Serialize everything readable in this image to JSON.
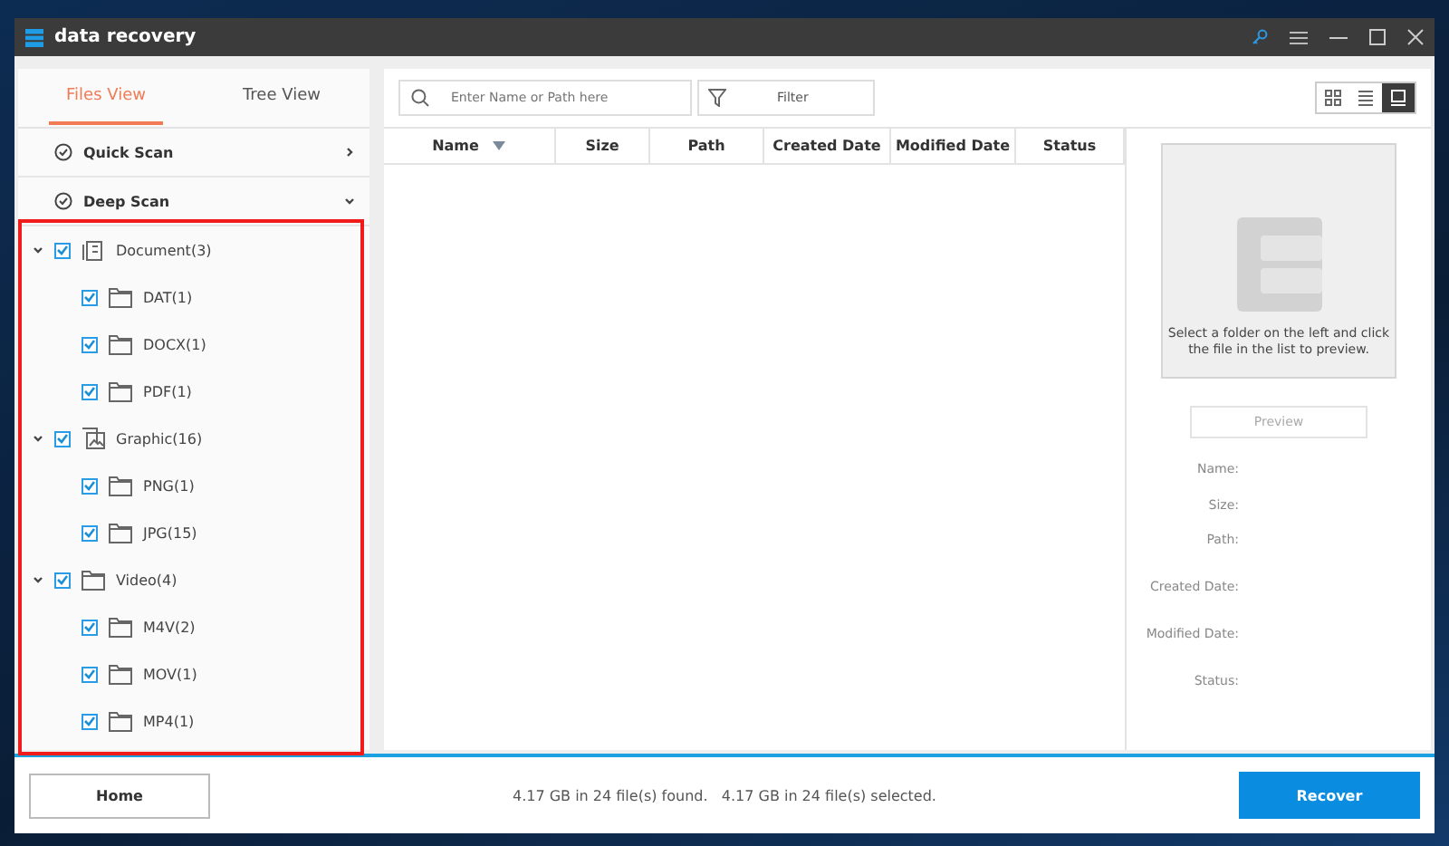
{
  "window": {
    "title": "data recovery"
  },
  "left_panel": {
    "tabs": [
      {
        "label": "Files View",
        "selected": true
      },
      {
        "label": "Tree View",
        "selected": false
      }
    ],
    "scans": [
      {
        "label": "Quick Scan",
        "expanded": false
      },
      {
        "label": "Deep Scan",
        "expanded": true
      }
    ],
    "tree": [
      {
        "label": "Document(3)",
        "kind": "document",
        "checked": true,
        "expanded": true,
        "children": [
          {
            "label": "DAT(1)",
            "checked": true
          },
          {
            "label": "DOCX(1)",
            "checked": true
          },
          {
            "label": "PDF(1)",
            "checked": true
          }
        ]
      },
      {
        "label": "Graphic(16)",
        "kind": "graphic",
        "checked": true,
        "expanded": true,
        "children": [
          {
            "label": "PNG(1)",
            "checked": true
          },
          {
            "label": "JPG(15)",
            "checked": true
          }
        ]
      },
      {
        "label": "Video(4)",
        "kind": "folder",
        "checked": true,
        "expanded": true,
        "children": [
          {
            "label": "M4V(2)",
            "checked": true
          },
          {
            "label": "MOV(1)",
            "checked": true
          },
          {
            "label": "MP4(1)",
            "checked": true
          }
        ]
      }
    ]
  },
  "toolbar": {
    "search": {
      "placeholder": "Enter Name or Path here"
    },
    "filter": "Filter",
    "view_modes": [
      {
        "kind": "grid",
        "selected": false
      },
      {
        "kind": "list",
        "selected": false
      },
      {
        "kind": "preview",
        "selected": true
      }
    ]
  },
  "table": {
    "columns": [
      {
        "label": "Name",
        "sortable": true
      },
      {
        "label": "Size",
        "sortable": false
      },
      {
        "label": "Path",
        "sortable": false
      },
      {
        "label": "Created Date",
        "sortable": false
      },
      {
        "label": "Modified Date",
        "sortable": false
      },
      {
        "label": "Status",
        "sortable": false
      }
    ]
  },
  "preview": {
    "message": "Select a folder on the left and click the file in the list to preview.",
    "button": {
      "label": "Preview",
      "disabled": true
    },
    "fields": [
      "Name:",
      "Size:",
      "Path:",
      "Created Date:",
      "Modified Date:",
      "Status:"
    ]
  },
  "footer": {
    "home": "Home",
    "status": "4.17 GB in 24 file(s) found.   4.17 GB in 24 file(s) selected.",
    "recover": "Recover"
  }
}
